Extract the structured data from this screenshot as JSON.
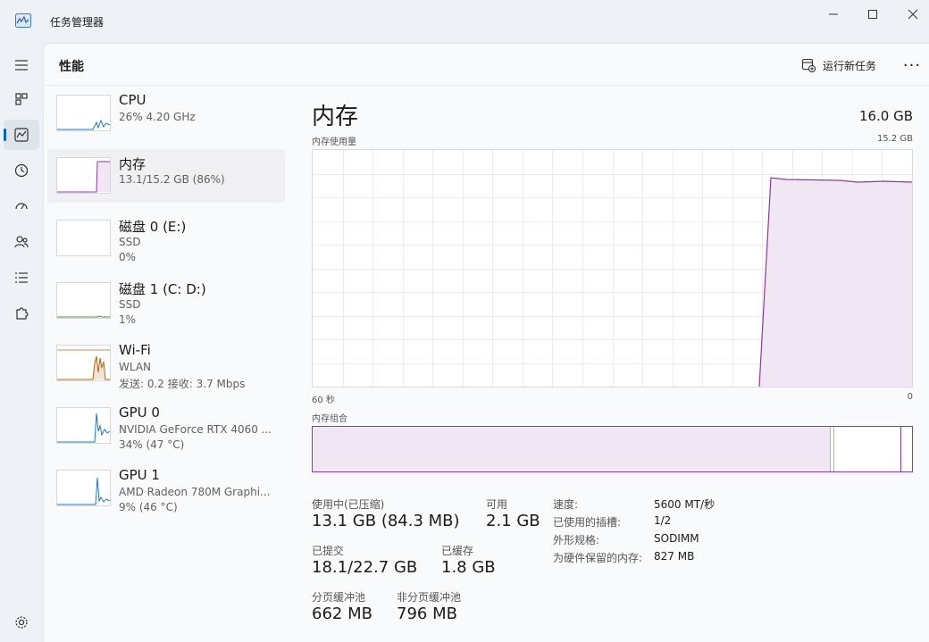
{
  "app": {
    "title": "任务管理器"
  },
  "header": {
    "page_title": "性能",
    "run_task_label": "运行新任务",
    "more_label": "···"
  },
  "resources": [
    {
      "name": "CPU",
      "line1": "26% 4.20 GHz",
      "line2": ""
    },
    {
      "name": "内存",
      "line1": "13.1/15.2 GB (86%)",
      "line2": ""
    },
    {
      "name": "磁盘 0 (E:)",
      "line1": "SSD",
      "line2": "0%"
    },
    {
      "name": "磁盘 1 (C: D:)",
      "line1": "SSD",
      "line2": "1%"
    },
    {
      "name": "Wi-Fi",
      "line1": "WLAN",
      "line2": "发送: 0.2 接收: 3.7 Mbps"
    },
    {
      "name": "GPU 0",
      "line1": "NVIDIA GeForce RTX 4060 ...",
      "line2": "34% (47 °C)"
    },
    {
      "name": "GPU 1",
      "line1": "AMD Radeon 780M Graphi...",
      "line2": "9% (46 °C)"
    }
  ],
  "detail": {
    "title": "内存",
    "total": "16.0 GB",
    "usage_label": "内存使用量",
    "usage_max": "15.2 GB",
    "axis_left": "60 秒",
    "axis_right": "0",
    "composition_label": "内存组合",
    "stats": {
      "in_use_label": "使用中(已压缩)",
      "in_use_value": "13.1 GB (84.3 MB)",
      "available_label": "可用",
      "available_value": "2.1 GB",
      "committed_label": "已提交",
      "committed_value": "18.1/22.7 GB",
      "cached_label": "已缓存",
      "cached_value": "1.8 GB",
      "paged_label": "分页缓冲池",
      "paged_value": "662 MB",
      "nonpaged_label": "非分页缓冲池",
      "nonpaged_value": "796 MB"
    },
    "specs": [
      {
        "label": "速度:",
        "value": "5600 MT/秒"
      },
      {
        "label": "已使用的插槽:",
        "value": "1/2"
      },
      {
        "label": "外形规格:",
        "value": "SODIMM"
      },
      {
        "label": "为硬件保留的内存:",
        "value": "827 MB"
      }
    ]
  },
  "colors": {
    "memory_accent": "#8b3a9f",
    "memory_fill": "#f1e6f4",
    "cpu_accent": "#1a78c2",
    "wifi_accent": "#b0631b",
    "nav_active": "#0a5fb8"
  }
}
